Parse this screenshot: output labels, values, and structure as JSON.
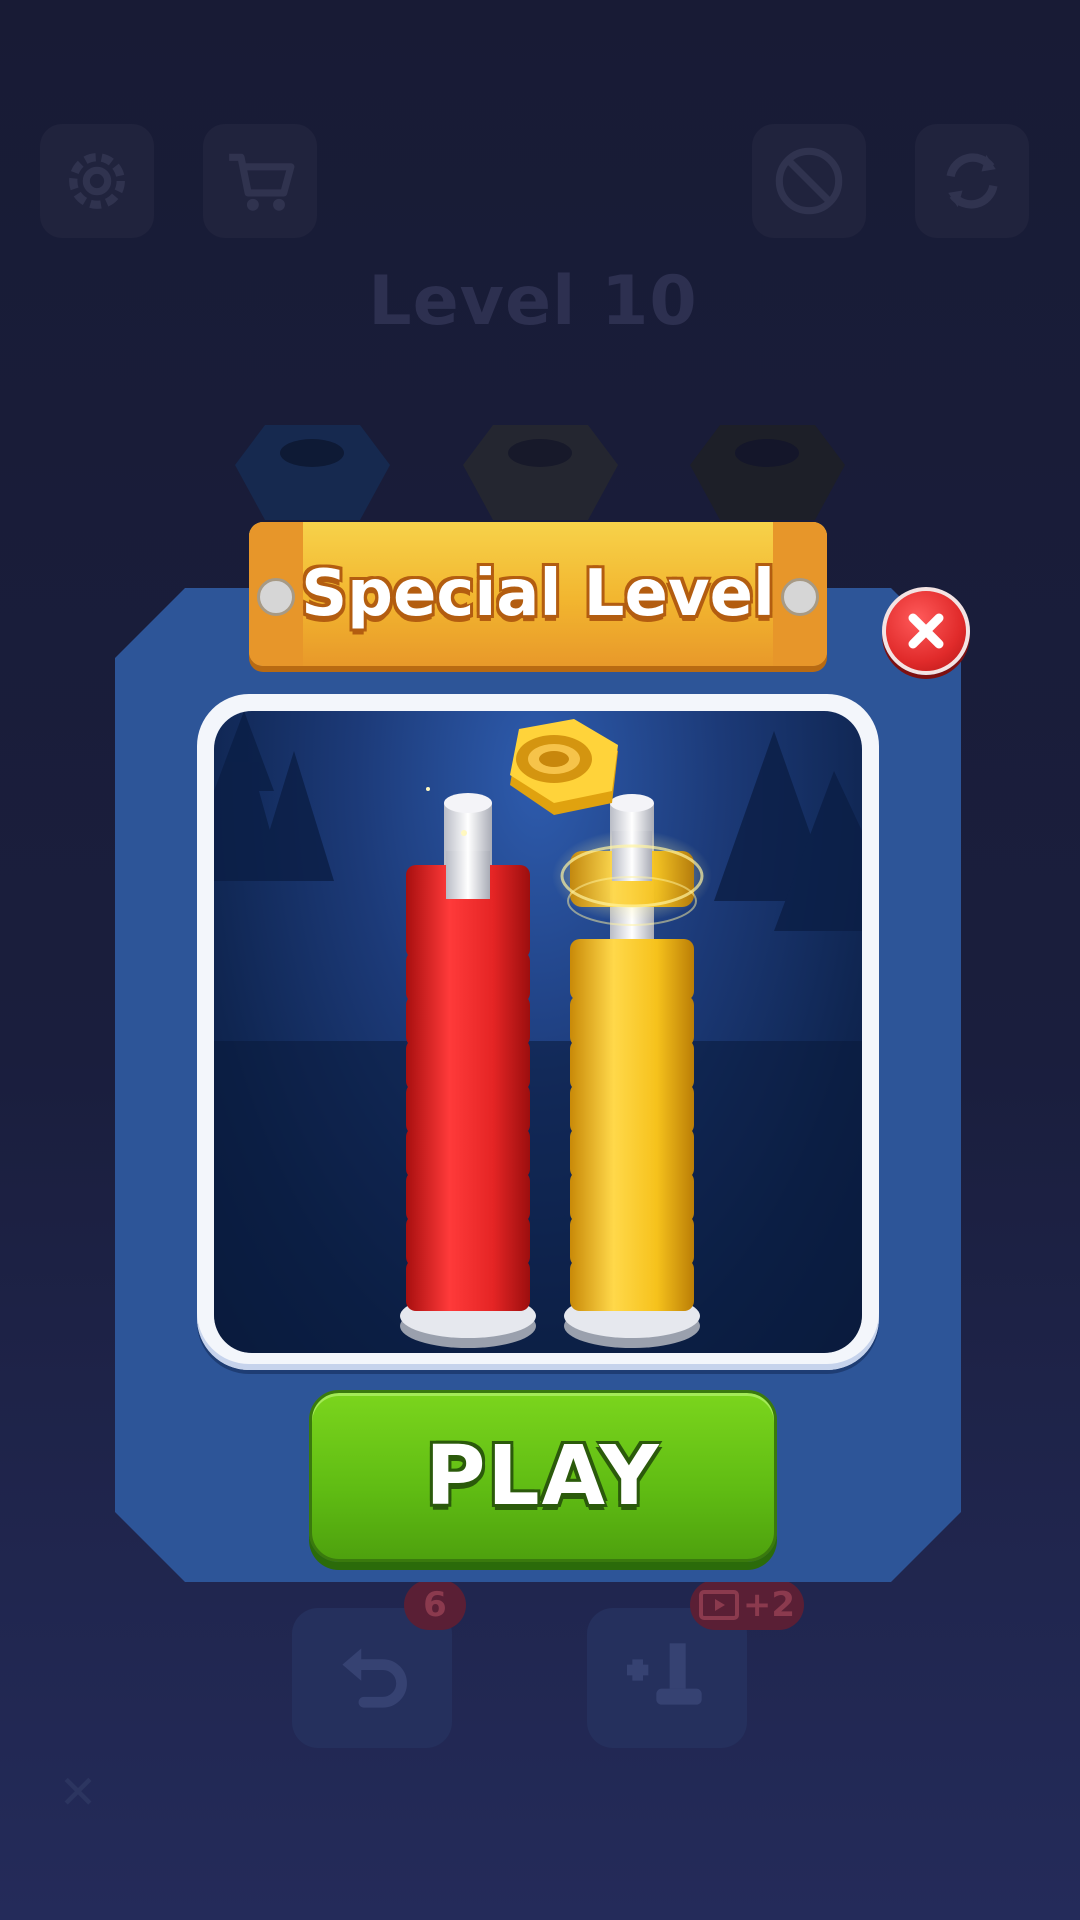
{
  "background": {
    "level_title": "Level 10",
    "undo_badge": "6",
    "add_badge_text": "+2",
    "top_buttons": [
      "settings-icon",
      "cart-icon",
      "no-ads-icon",
      "restart-icon"
    ],
    "bottom_buttons": [
      "undo-icon",
      "add-bolt-icon"
    ],
    "dismiss_icon": "close-x-icon"
  },
  "modal": {
    "title": "Special Level",
    "play_label": "PLAY",
    "close_icon": "close-icon",
    "preview": {
      "red_stack_nuts": 9,
      "yellow_stack_nuts": 9,
      "floating_nut_color": "yellow"
    }
  },
  "colors": {
    "panel": "#2d5598",
    "ribbon": "#f2b52f",
    "play": "#5fbb13",
    "close": "#e12b2b",
    "nut_red": "#e52525",
    "nut_yellow": "#f6c21c"
  }
}
